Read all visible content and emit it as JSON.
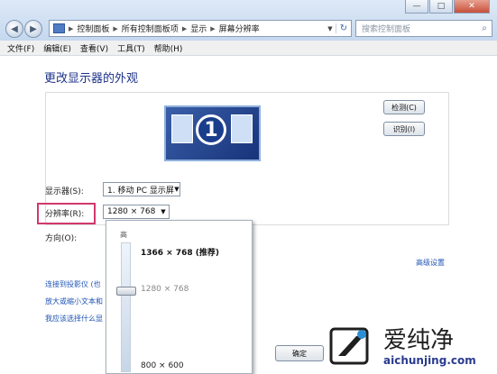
{
  "window": {
    "controls": {
      "minimize": "—",
      "maximize": "□",
      "close": "✕"
    }
  },
  "addressbar": {
    "breadcrumbs": [
      "控制面板",
      "所有控制面板项",
      "显示",
      "屏幕分辨率"
    ],
    "search_placeholder": "搜索控制面板"
  },
  "menubar": {
    "items": [
      "文件(F)",
      "编辑(E)",
      "查看(V)",
      "工具(T)",
      "帮助(H)"
    ]
  },
  "main": {
    "title": "更改显示器的外观",
    "monitor_number": "1",
    "detect_button": "检测(C)",
    "identify_button": "识别(I)",
    "display_label": "显示器(S):",
    "display_value": "1. 移动 PC 显示屏",
    "resolution_label": "分辨率(R):",
    "resolution_value": "1280 × 768",
    "orientation_label": "方向(O):",
    "advanced_link": "高级设置",
    "links": [
      "连接到投影仪 (也",
      "放大或缩小文本和",
      "我应该选择什么显"
    ],
    "ok_button": "确定"
  },
  "resolution_dropdown": {
    "high_label": "高",
    "options": [
      "1366 × 768 (推荐)",
      "1280 × 768",
      "800 × 600"
    ],
    "selected_value": "1280 × 768"
  },
  "watermark": {
    "title": "爱纯净",
    "url": "aichunjing.com"
  },
  "colors": {
    "title_blue": "#1e3287",
    "link_blue": "#1f54b4",
    "highlight_pink": "#d2386c"
  }
}
